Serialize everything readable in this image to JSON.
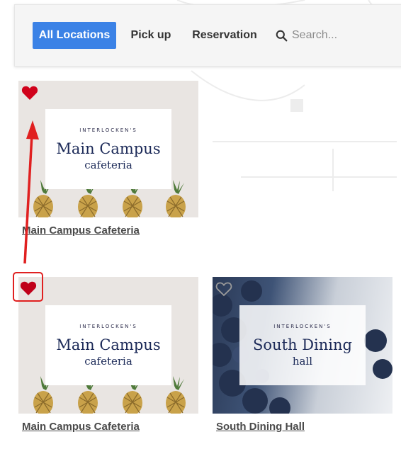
{
  "filters": {
    "tabs": [
      {
        "label": "All Locations",
        "active": true
      },
      {
        "label": "Pick up",
        "active": false
      },
      {
        "label": "Reservation",
        "active": false
      }
    ],
    "search": {
      "placeholder": "Search...",
      "icon": "search-icon"
    }
  },
  "colors": {
    "accent": "#3b82e6",
    "favorite": "#d0021b",
    "annotation": "#e02020",
    "title_text": "#1c2a58"
  },
  "locations": [
    {
      "name": "Main Campus Cafeteria",
      "favorited": true,
      "image": {
        "top_line": "INTERLOCKEN'S",
        "headline": "Main Campus",
        "subline": "cafeteria",
        "theme": "pineapples"
      }
    },
    {
      "name": "Main Campus Cafeteria",
      "favorited": true,
      "image": {
        "top_line": "INTERLOCKEN'S",
        "headline": "Main Campus",
        "subline": "cafeteria",
        "theme": "pineapples"
      }
    },
    {
      "name": "South Dining Hall",
      "favorited": false,
      "image": {
        "top_line": "INTERLOCKEN'S",
        "headline": "South Dining",
        "subline": "hall",
        "theme": "blueberries"
      }
    }
  ]
}
